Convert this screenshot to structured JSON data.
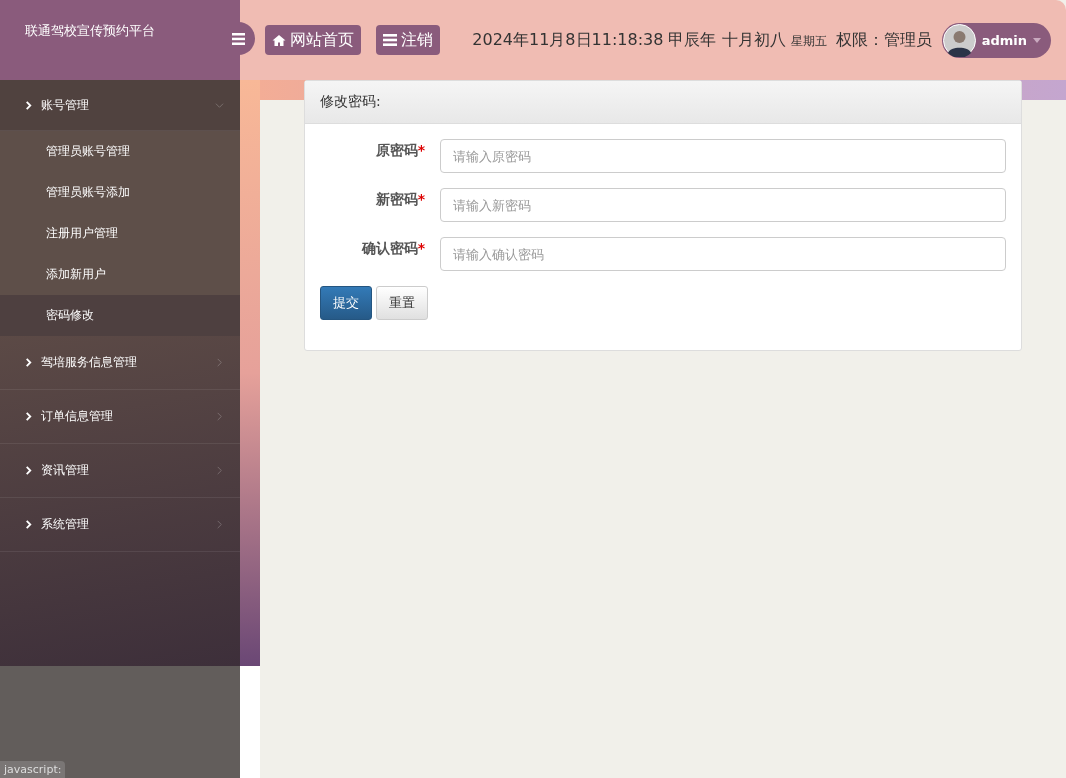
{
  "header": {
    "brand": "联通驾校宣传预约平台",
    "nav_buttons": [
      {
        "kind": "home",
        "label": "网站首页"
      },
      {
        "kind": "menu",
        "label": "注销"
      }
    ],
    "datetime": "2024年11月8日11:18:38 甲辰年 十月初八",
    "weekday": "星期五",
    "role": "权限：管理员",
    "user": "admin"
  },
  "sidebar": {
    "groups": [
      {
        "label": "账号管理",
        "expanded": true,
        "children": [
          {
            "label": "管理员账号管理",
            "selected": false
          },
          {
            "label": "管理员账号添加",
            "selected": false
          },
          {
            "label": "注册用户管理",
            "selected": false
          },
          {
            "label": "添加新用户",
            "selected": false
          },
          {
            "label": "密码修改",
            "selected": true
          }
        ]
      },
      {
        "label": "驾培服务信息管理",
        "expanded": false
      },
      {
        "label": "订单信息管理",
        "expanded": false
      },
      {
        "label": "资讯管理",
        "expanded": false
      },
      {
        "label": "系统管理",
        "expanded": false
      }
    ]
  },
  "form": {
    "title": "修改密码:",
    "fields": [
      {
        "label": "原密码",
        "required": "*",
        "placeholder": "请输入原密码"
      },
      {
        "label": "新密码",
        "required": "*",
        "placeholder": "请输入新密码"
      },
      {
        "label": "确认密码",
        "required": "*",
        "placeholder": "请输入确认密码"
      }
    ],
    "buttons": [
      {
        "kind": "primary",
        "label": "提交"
      },
      {
        "kind": "default",
        "label": "重置"
      }
    ]
  },
  "status_bar": "javascript:"
}
